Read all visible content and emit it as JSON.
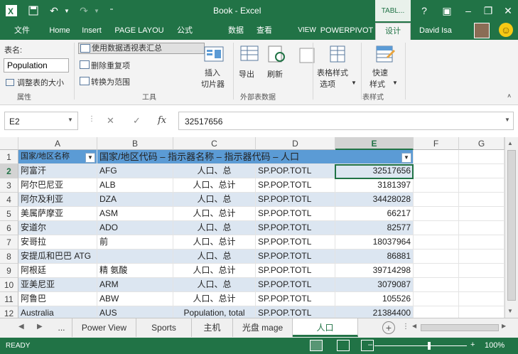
{
  "window": {
    "title": "Book - Excel",
    "context_tab": "TABL...",
    "help": "?",
    "user": "David Isa"
  },
  "ribbon_tabs": [
    "文件",
    "Home",
    "Insert",
    "PAGE LAYOU",
    "公式",
    "数据",
    "查看",
    "VIEW",
    "POWERPIVOT",
    "设计"
  ],
  "ribbon": {
    "table_name_label": "表名:",
    "table_name_value": "Population",
    "resize": "调整表的大小",
    "group_properties": "属性",
    "pivot": "使用数据透视表汇总",
    "remove_dup": "删除重复项",
    "convert": "转换为范围",
    "slicer1": "插入",
    "slicer2": "切片器",
    "group_tools": "工具",
    "export": "导出",
    "refresh": "刷新",
    "group_external": "外部表数据",
    "style_opts1": "表格样式",
    "style_opts2": "选项",
    "quick1": "快速",
    "quick2": "样式",
    "group_styles": "表样式"
  },
  "formula_bar": {
    "cell_ref": "E2",
    "cancel": "✕",
    "enter": "✓",
    "fx": "fx",
    "value": "32517656"
  },
  "columns": [
    "A",
    "B",
    "C",
    "D",
    "E",
    "F",
    "G"
  ],
  "table": {
    "header_a": "国家/地区名称",
    "header_rest": "国家/地区代码 – 指示器名称 – 指示器代码 – 人口",
    "rows": [
      {
        "n": "2",
        "a": "阿富汗",
        "b": "AFG",
        "c": "人口、总",
        "d": "SP.POP.TOTL",
        "e": "32517656"
      },
      {
        "n": "3",
        "a": "阿尔巴尼亚",
        "b": "ALB",
        "c": "人口、总计",
        "d": "SP.POP.TOTL",
        "e": "3181397"
      },
      {
        "n": "4",
        "a": "阿尔及利亚",
        "b": "DZA",
        "c": "人口、总",
        "d": "SP.POP.TOTL",
        "e": "34428028"
      },
      {
        "n": "5",
        "a": "美属萨摩亚",
        "b": "ASM",
        "c": "人口、总计",
        "d": "SP.POP.TOTL",
        "e": "66217"
      },
      {
        "n": "6",
        "a": "安道尔",
        "b": "ADO",
        "c": "人口、总",
        "d": "SP.POP.TOTL",
        "e": "82577"
      },
      {
        "n": "7",
        "a": "安哥拉",
        "b": "前",
        "c": "人口、总计",
        "d": "SP.POP.TOTL",
        "e": "18037964"
      },
      {
        "n": "8",
        "a": "安提瓜和巴巴 ATG",
        "b": "",
        "c": "人口、总",
        "d": "SP.POP.TOTL",
        "e": "86881"
      },
      {
        "n": "9",
        "a": "阿根廷",
        "b": "精 氨酸",
        "c": "人口、总计",
        "d": "SP.POP.TOTL",
        "e": "39714298"
      },
      {
        "n": "10",
        "a": "亚美尼亚",
        "b": "ARM",
        "c": "人口、总",
        "d": "SP.POP.TOTL",
        "e": "3079087"
      },
      {
        "n": "11",
        "a": "阿鲁巴",
        "b": "ABW",
        "c": "人口、总计",
        "d": "SP.POP.TOTL",
        "e": "105526"
      },
      {
        "n": "12",
        "a": "Australia",
        "b": "AUS",
        "c": "Population, total",
        "d": "SP.POP.TOTL",
        "e": "21384400"
      }
    ]
  },
  "sheet_tabs": [
    "...",
    "Power View",
    "Sports",
    "主机",
    "光盘 mage",
    "人口"
  ],
  "status": {
    "ready": "READY",
    "zoom": "100%"
  }
}
